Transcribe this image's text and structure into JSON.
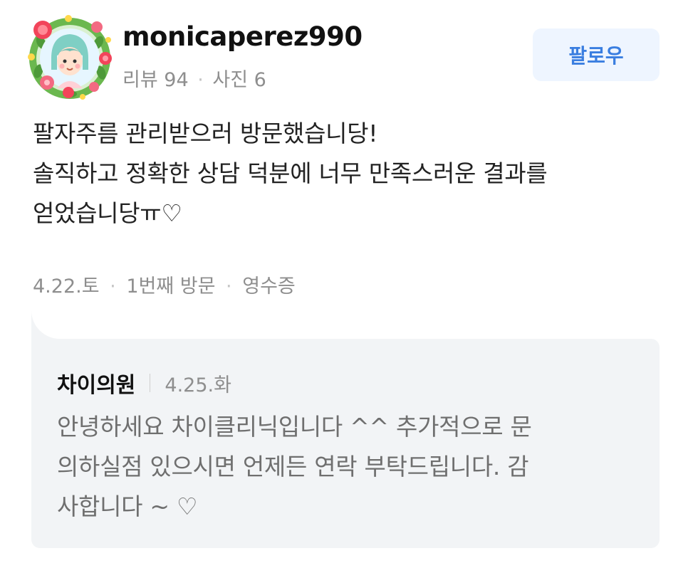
{
  "reviewer": {
    "username": "monicaperez990",
    "stats": {
      "reviews": "리뷰 94",
      "photos": "사진 6",
      "separator": "·"
    },
    "avatar_icon": "flower-wreath-avatar-icon"
  },
  "follow_button": {
    "label": "팔로우"
  },
  "review": {
    "lines": [
      "팔자주름 관리받으러 방문했습니당!",
      "솔직하고 정확한 상담 덕분에 너무 만족스러운 결과를",
      "얻었습니당ㅠ♡"
    ],
    "meta": {
      "date": "4.22.토",
      "visit": "1번째 방문",
      "receipt": "영수증",
      "separator": "·"
    }
  },
  "reply": {
    "author": "차이의원",
    "date": "4.25.화",
    "lines": [
      "안녕하세요 차이클리닉입니다 ^^ 추가적으로 문",
      "의하실점 있으시면 언제든 연락 부탁드립니다. 감",
      "사합니다 ~ ♡"
    ]
  },
  "colors": {
    "follow_bg": "#eef5ff",
    "follow_text": "#3a7ee0",
    "reply_bg": "#f2f4f6",
    "muted_text": "#8e8e8e"
  }
}
